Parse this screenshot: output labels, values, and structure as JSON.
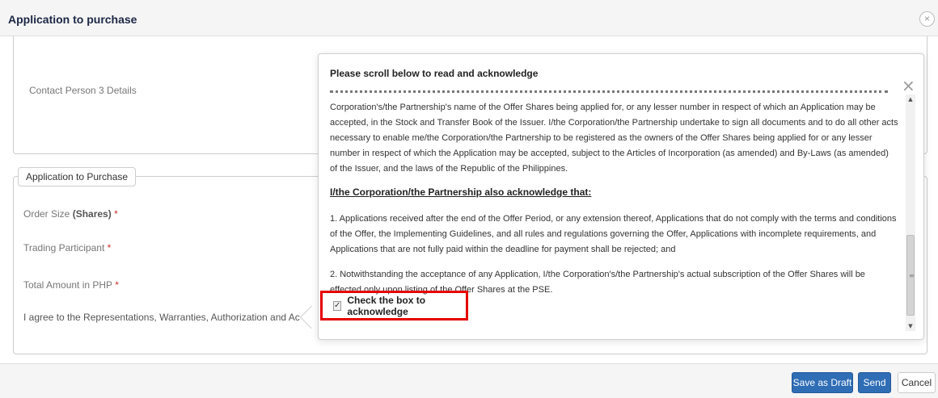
{
  "modal": {
    "title": "Application to purchase",
    "close_icon": "×"
  },
  "contact": {
    "label": "Contact Person 3 Details"
  },
  "application_section": {
    "legend": "Application to Purchase",
    "fields": {
      "order_size": {
        "label": "Order Size",
        "bold_part": "(Shares)",
        "required": "*"
      },
      "trading_participant": {
        "label": "Trading Participant",
        "required": "*"
      },
      "total_amount": {
        "label": "Total Amount in PHP",
        "required": "*"
      },
      "agree": {
        "label": "I agree to the Representations, Warranties, Authorization and Acknowledgm"
      }
    }
  },
  "popover": {
    "title": "Please scroll below to read and acknowledge",
    "close_icon": "×",
    "paragraph_1": "Corporation's/the Partnership's name of the Offer Shares being applied for, or any lesser number in respect of which an Application may be accepted, in the Stock and Transfer Book of the Issuer. I/the Corporation/the Partnership undertake to sign all documents and to do all other acts necessary to enable me/the Corporation/the Partnership to be registered as the owners of the Offer Shares being applied for or any lesser number in respect of which the Application may be accepted, subject to the Articles of Incorporation (as amended) and By-Laws (as amended) of the Issuer, and the laws of the Republic of the Philippines.",
    "acknowledge_heading": "I/the Corporation/the Partnership also acknowledge that:",
    "item_1": "1. Applications received after the end of the Offer Period, or any extension thereof, Applications that do not comply with the terms and conditions of the Offer, the Implementing Guidelines, and all rules and regulations governing the Offer, Applications with incomplete requirements, and Applications that are not fully paid within the deadline for payment shall be rejected; and",
    "item_2": "2. Notwithstanding the acceptance of any Application, I/the Corporation's/the Partnership's actual subscription of the Offer Shares will be effected only upon listing of the Offer Shares at the PSE.",
    "checkbox_checked": true,
    "checkbox_label": "Check the box to acknowledge",
    "scrollbar": {
      "up_icon": "▲",
      "down_icon": "▼",
      "grip_icon": "≡"
    }
  },
  "footer": {
    "save_draft": "Save as Draft",
    "send": "Send",
    "cancel": "Cancel"
  },
  "colors": {
    "primary": "#2f6db5",
    "highlight": "#e60000",
    "title": "#1c2745",
    "required": "#c9302c"
  }
}
